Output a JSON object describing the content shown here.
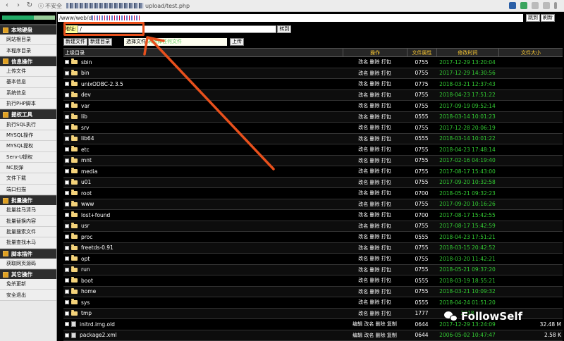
{
  "browser": {
    "security_label": "不安全",
    "url_suffix": "upload/test.php"
  },
  "sidebar": {
    "groups": [
      {
        "title": "本地硬盘",
        "items": [
          "网站根目录",
          "本程序目录"
        ]
      },
      {
        "title": "信息操作",
        "items": [
          "上传文件",
          "基本信息",
          "系统信息",
          "执行PHP脚本"
        ]
      },
      {
        "title": "提权工具",
        "items": [
          "执行SQL执行",
          "MYSQL操作",
          "MYSQL提权",
          "Serv-U提权",
          "NC反弹",
          "文件下载",
          "端口扫描"
        ]
      },
      {
        "title": "批量操作",
        "items": [
          "批量挂马清马",
          "批量替换内容",
          "批量搜索文件",
          "批量查找木马"
        ]
      },
      {
        "title": "脚本插件",
        "items": [
          "获取网页源码"
        ]
      },
      {
        "title": "其它操作",
        "items": [
          "免杀更新",
          "安全退出"
        ]
      }
    ]
  },
  "pathbar": {
    "path_prefix": "/www/web/d",
    "jump_label": "跳到",
    "refresh_label": "刷新"
  },
  "address": {
    "label": "地址:",
    "value": "/",
    "go_label": "转到"
  },
  "toolbar": {
    "new_file": "新建文件",
    "new_dir": "新建目录",
    "choose_file": "选择文件",
    "no_file_chosen": "未选择任何文件",
    "upload": "上传"
  },
  "table": {
    "headers": {
      "name": "上级目录",
      "action": "操作",
      "perm": "文件属性",
      "time": "修改时间",
      "size": "文件大小"
    },
    "rows": [
      {
        "type": "dir",
        "name": "sbin",
        "action": "改名 删除 打包",
        "perm": "0755",
        "time": "2017-12-29 13:20:04",
        "size": ""
      },
      {
        "type": "dir",
        "name": "bin",
        "action": "改名 删除 打包",
        "perm": "0755",
        "time": "2017-12-29 14:30:56",
        "size": ""
      },
      {
        "type": "dir",
        "name": "unixODBC-2.3.5",
        "action": "改名 删除 打包",
        "perm": "0775",
        "time": "2018-03-21 12:37:43",
        "size": ""
      },
      {
        "type": "dir",
        "name": "dev",
        "action": "改名 删除 打包",
        "perm": "0755",
        "time": "2018-04-23 17:51:22",
        "size": ""
      },
      {
        "type": "dir",
        "name": "var",
        "action": "改名 删除 打包",
        "perm": "0755",
        "time": "2017-09-19 09:52:14",
        "size": ""
      },
      {
        "type": "dir",
        "name": "lib",
        "action": "改名 删除 打包",
        "perm": "0555",
        "time": "2018-03-14 10:01:23",
        "size": ""
      },
      {
        "type": "dir",
        "name": "srv",
        "action": "改名 删除 打包",
        "perm": "0755",
        "time": "2017-12-28 20:06:19",
        "size": ""
      },
      {
        "type": "dir",
        "name": "lib64",
        "action": "改名 删除 打包",
        "perm": "0555",
        "time": "2018-03-14 10:01:22",
        "size": ""
      },
      {
        "type": "dir",
        "name": "etc",
        "action": "改名 删除 打包",
        "perm": "0755",
        "time": "2018-04-23 17:48:14",
        "size": ""
      },
      {
        "type": "dir",
        "name": "mnt",
        "action": "改名 删除 打包",
        "perm": "0755",
        "time": "2017-02-16 04:19:40",
        "size": ""
      },
      {
        "type": "dir",
        "name": "media",
        "action": "改名 删除 打包",
        "perm": "0755",
        "time": "2017-08-17 15:43:00",
        "size": ""
      },
      {
        "type": "dir",
        "name": "u01",
        "action": "改名 删除 打包",
        "perm": "0755",
        "time": "2017-09-20 10:32:58",
        "size": ""
      },
      {
        "type": "dir",
        "name": "root",
        "action": "改名 删除 打包",
        "perm": "0700",
        "time": "2018-05-21 09:32:23",
        "size": ""
      },
      {
        "type": "dir",
        "name": "www",
        "action": "改名 删除 打包",
        "perm": "0755",
        "time": "2017-09-20 10:16:26",
        "size": ""
      },
      {
        "type": "dir",
        "name": "lost+found",
        "action": "改名 删除 打包",
        "perm": "0700",
        "time": "2017-08-17 15:42:55",
        "size": ""
      },
      {
        "type": "dir",
        "name": "usr",
        "action": "改名 删除 打包",
        "perm": "0755",
        "time": "2017-08-17 15:42:59",
        "size": ""
      },
      {
        "type": "dir",
        "name": "proc",
        "action": "改名 删除 打包",
        "perm": "0555",
        "time": "2018-04-23 17:51:21",
        "size": ""
      },
      {
        "type": "dir",
        "name": "freetds-0.91",
        "action": "改名 删除 打包",
        "perm": "0755",
        "time": "2018-03-15 20:42:52",
        "size": ""
      },
      {
        "type": "dir",
        "name": "opt",
        "action": "改名 删除 打包",
        "perm": "0755",
        "time": "2018-03-20 11:42:21",
        "size": ""
      },
      {
        "type": "dir",
        "name": "run",
        "action": "改名 删除 打包",
        "perm": "0755",
        "time": "2018-05-21 09:37:20",
        "size": ""
      },
      {
        "type": "dir",
        "name": "boot",
        "action": "改名 删除 打包",
        "perm": "0555",
        "time": "2018-03-19 18:55:21",
        "size": ""
      },
      {
        "type": "dir",
        "name": "home",
        "action": "改名 删除 打包",
        "perm": "0755",
        "time": "2018-03-21 10:09:32",
        "size": ""
      },
      {
        "type": "dir",
        "name": "sys",
        "action": "改名 删除 打包",
        "perm": "0555",
        "time": "2018-04-24 01:51:20",
        "size": ""
      },
      {
        "type": "dir",
        "name": "tmp",
        "action": "改名 删除 打包",
        "perm": "1777",
        "time": "2018",
        "size": ""
      },
      {
        "type": "file",
        "name": "initrd.img.old",
        "action": "编辑 改名 删除 复制",
        "perm": "0644",
        "time": "2017-12-29 13:24:09",
        "size": "32.48 M"
      },
      {
        "type": "file",
        "name": "package2.xml",
        "action": "编辑 改名 删除 复制",
        "perm": "0644",
        "time": "2006-05-02 10:47:47",
        "size": "2.58 K"
      }
    ]
  },
  "watermark": {
    "text": "FollowSelf"
  },
  "colors": {
    "annotation": "#e8501c",
    "time_green": "#33cc33",
    "header_yellow": "#ffcc33"
  }
}
